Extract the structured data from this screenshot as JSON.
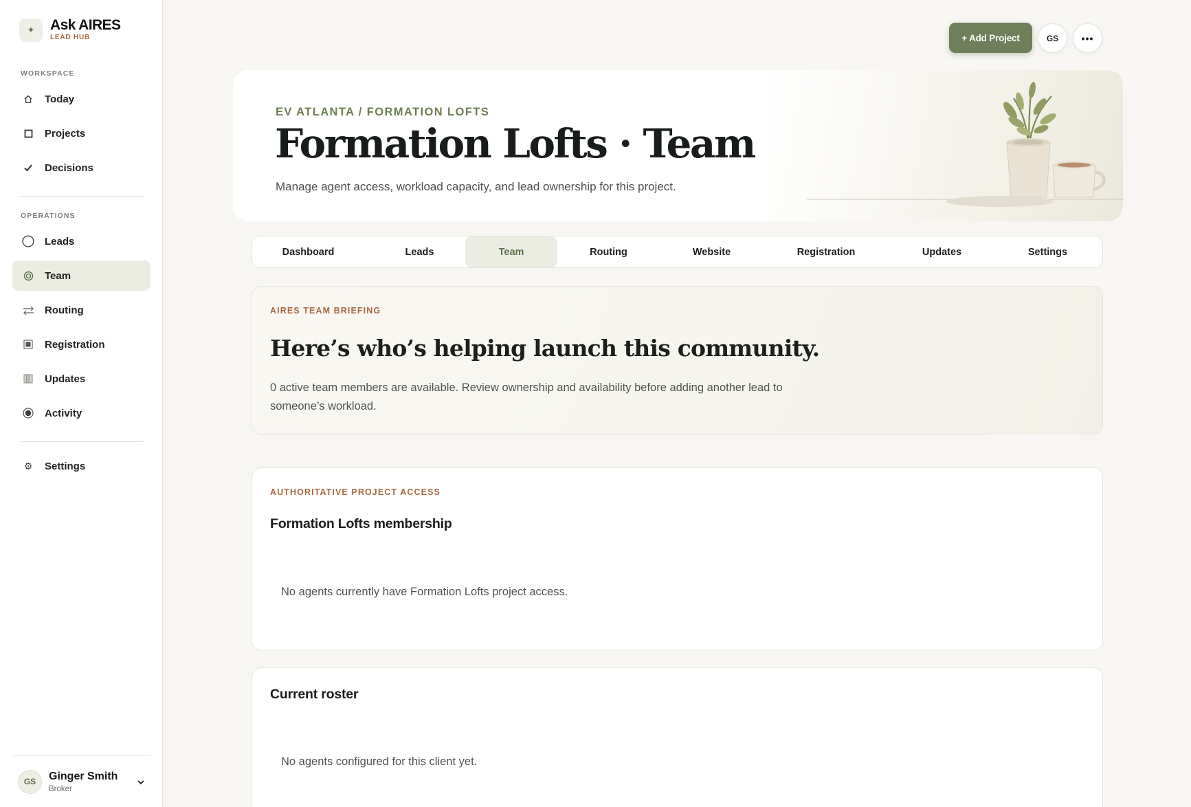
{
  "brand": {
    "mark": "✦",
    "name": "Ask AIRES",
    "subtitle": "LEAD HUB"
  },
  "sidebar": {
    "workspace_label": "WORKSPACE",
    "workspace_items": [
      {
        "label": "Today",
        "icon": "home-icon"
      },
      {
        "label": "Projects",
        "icon": "square-icon"
      },
      {
        "label": "Decisions",
        "icon": "check-icon"
      }
    ],
    "operations_label": "OPERATIONS",
    "operations_items": [
      {
        "label": "Leads",
        "icon": "circle-icon"
      },
      {
        "label": "Team",
        "icon": "target-icon",
        "active": true
      },
      {
        "label": "Routing",
        "icon": "arrows-icon"
      },
      {
        "label": "Registration",
        "icon": "filled-square-icon"
      },
      {
        "label": "Updates",
        "icon": "grid-icon"
      },
      {
        "label": "Activity",
        "icon": "radio-icon"
      }
    ],
    "settings_item": {
      "label": "Settings",
      "icon": "gear-icon"
    }
  },
  "user": {
    "initials": "GS",
    "name": "Ginger Smith",
    "role": "Broker"
  },
  "topbar": {
    "add_project_label": "+ Add Project",
    "avatar_initials": "GS",
    "more_label": "•••"
  },
  "hero": {
    "eyebrow": "EV ATLANTA / FORMATION LOFTS",
    "title": "Formation Lofts · Team",
    "subtitle": "Manage agent access, workload capacity, and lead ownership for this project."
  },
  "tabs": [
    {
      "label": "Dashboard"
    },
    {
      "label": "Leads"
    },
    {
      "label": "Team",
      "active": true
    },
    {
      "label": "Routing"
    },
    {
      "label": "Website"
    },
    {
      "label": "Registration"
    },
    {
      "label": "Updates"
    },
    {
      "label": "Settings"
    }
  ],
  "briefing": {
    "eyebrow": "AIRES TEAM BRIEFING",
    "title": "Here’s who’s helping launch this community.",
    "body": "0 active team members are available. Review ownership and availability before adding another lead to someone’s workload."
  },
  "access": {
    "eyebrow": "AUTHORITATIVE PROJECT ACCESS",
    "title": "Formation Lofts membership",
    "empty": "No agents currently have Formation Lofts project access."
  },
  "roster": {
    "title": "Current roster",
    "empty": "No agents configured for this client yet."
  },
  "colors": {
    "accent": "#6e7f59",
    "eyebrow_green": "#6d7f4f",
    "eyebrow_clay": "#a9683f",
    "active_bg": "#ebede3"
  }
}
